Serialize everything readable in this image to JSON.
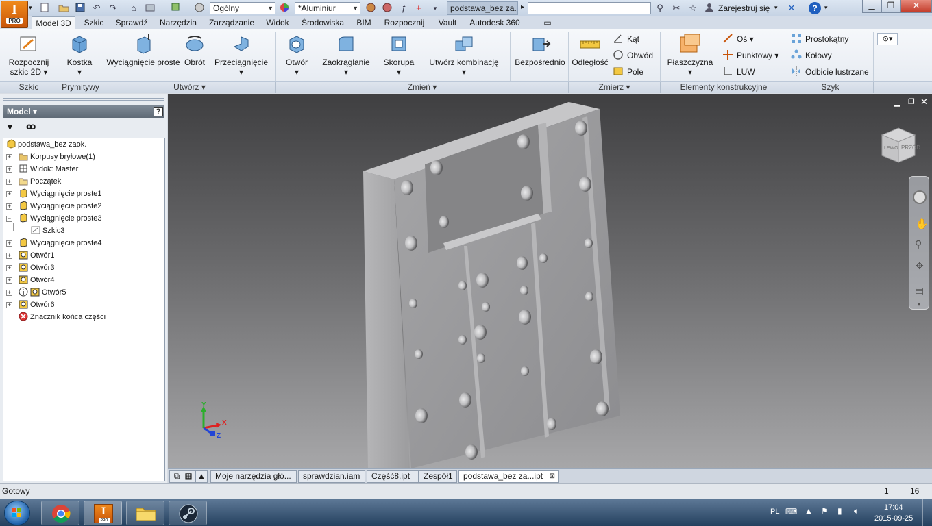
{
  "titlebar": {
    "style_combo": "Ogólny",
    "material_combo": "*Aluminiur",
    "document_title": "podstawa_bez za...",
    "signin": "Zarejestruj się",
    "help_label": "?"
  },
  "app": {
    "logo_letter": "I",
    "logo_badge": "PRO"
  },
  "ribbon_tabs": [
    "Model 3D",
    "Szkic",
    "Sprawdź",
    "Narzędzia",
    "Zarządzanie",
    "Widok",
    "Środowiska",
    "BIM",
    "Rozpocznij",
    "Vault",
    "Autodesk 360"
  ],
  "ribbon": {
    "sketch_line1": "Rozpocznij",
    "sketch_line2": "szkic 2D",
    "box": "Kostka",
    "extrude": "Wyciągnięcie proste",
    "revolve": "Obrót",
    "sweep": "Przeciągnięcie",
    "hole": "Otwór",
    "fillet": "Zaokrąglanie",
    "shell": "Skorupa",
    "combine": "Utwórz kombinację",
    "direct": "Bezpośrednio",
    "distance": "Odległość",
    "angle": "Kąt",
    "perimeter": "Obwód",
    "area": "Pole",
    "plane": "Płaszczyzna",
    "axis": "Oś",
    "point": "Punktowy",
    "ucs": "LUW",
    "rect_pattern": "Prostokątny",
    "circ_pattern": "Kołowy",
    "mirror": "Odbicie lustrzane"
  },
  "groups": [
    "Szkic",
    "Prymitywy",
    "Utwórz",
    "Zmień",
    "Zmierz",
    "Elementy konstrukcyjne",
    "Szyk"
  ],
  "panel": {
    "title": "Model",
    "help": "?"
  },
  "tree": [
    {
      "label": "podstawa_bez zaok.",
      "icon": "part"
    },
    {
      "label": "Korpusy bryłowe(1)",
      "icon": "folder-solid"
    },
    {
      "label": "Widok: Master",
      "icon": "view"
    },
    {
      "label": "Początek",
      "icon": "folder"
    },
    {
      "label": "Wyciągnięcie proste1",
      "icon": "extrude"
    },
    {
      "label": "Wyciągnięcie proste2",
      "icon": "extrude"
    },
    {
      "label": "Wyciągnięcie proste3",
      "icon": "extrude"
    },
    {
      "label": "Szkic3",
      "icon": "sketch"
    },
    {
      "label": "Wyciągnięcie proste4",
      "icon": "extrude"
    },
    {
      "label": "Otwór1",
      "icon": "hole"
    },
    {
      "label": "Otwór3",
      "icon": "hole"
    },
    {
      "label": "Otwór4",
      "icon": "hole"
    },
    {
      "label": "Otwór5",
      "icon": "hole"
    },
    {
      "label": "Otwór6",
      "icon": "hole"
    },
    {
      "label": "Znacznik końca części",
      "icon": "end"
    }
  ],
  "viewcube": {
    "face_left": "LEWO",
    "face_front": "PRZÓD"
  },
  "triad": {
    "x": "X",
    "y": "Y",
    "z": "Z"
  },
  "doc_tabs": [
    "Moje narzędzia głó...",
    "sprawdzian.iam",
    "Część8.ipt",
    "Zespół1",
    "podstawa_bez za...ipt"
  ],
  "status": {
    "text": "Gotowy",
    "count1": "1",
    "count2": "16"
  },
  "taskbar": {
    "lang": "PL",
    "time": "17:04",
    "date": "2015-09-25"
  },
  "colors": {
    "accent": "#e3801a",
    "viewport_top": "#3f3f41",
    "viewport_bottom": "#a7a7a9"
  }
}
